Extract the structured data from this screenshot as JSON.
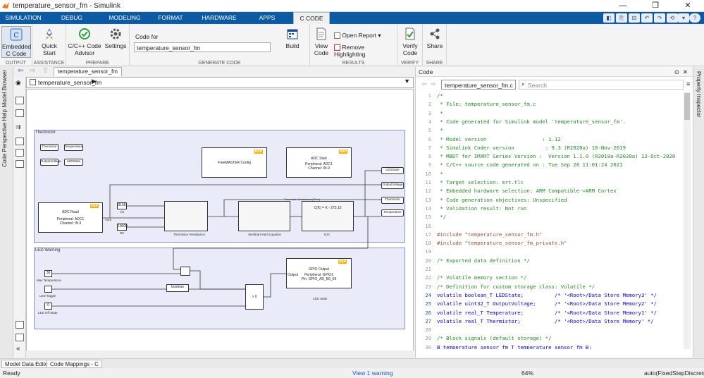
{
  "window": {
    "title": "temperature_sensor_fm - Simulink",
    "controls": [
      "—",
      "❐",
      "✕"
    ]
  },
  "ribbon_tabs": [
    "SIMULATION",
    "DEBUG",
    "MODELING",
    "FORMAT",
    "HARDWARE",
    "APPS",
    "C CODE"
  ],
  "quick_access": [
    "◧",
    "⎘",
    "⊟",
    "↶",
    "↷",
    "⟲",
    "▾",
    "?"
  ],
  "ribbon": {
    "groups": {
      "output": "OUTPUT",
      "assistance": "ASSISTANCE",
      "prepare": "PREPARE",
      "generate_code": "GENERATE CODE",
      "results": "RESULTS",
      "verify": "VERIFY",
      "share": "SHARE"
    },
    "embedded_label": "Embedded",
    "embedded_sub": "C Code",
    "quick_start_1": "Quick",
    "quick_start_2": "Start",
    "advisor_1": "C/C++ Code",
    "advisor_2": "Advisor",
    "settings": "Settings",
    "code_for_label": "Code for",
    "code_for_value": "temperature_sensor_fm",
    "build": "Build",
    "view_code_1": "View",
    "view_code_2": "Code",
    "open_report": "Open Report",
    "remove_highlighting": "Remove Highlighting",
    "verify_code_1": "Verify",
    "verify_code_2": "Code",
    "share": "Share"
  },
  "editor": {
    "tab": "temperature_sensor_fm",
    "breadcrumb": "temperature_sensor_fm"
  },
  "side_tabs": [
    "Model Browser",
    "Code Perspective Help"
  ],
  "right_tab": "Property Inspector",
  "diagram": {
    "thermistor_area": "Thermistor",
    "led_area": "LED Warning",
    "top_ports": [
      "Thermistor",
      "Temperature",
      "OutputVoltage",
      "LEDState"
    ],
    "freemaster": "FreeMASTER Config",
    "adc_start": "ADC Start",
    "adc_start_info": "Peripheral: ADC1",
    "adc_start_ch": "Channel: IN.9",
    "adc_read": "ADC Read",
    "adc_read_info": "Peripheral: ADC1",
    "adc_read_ch": "Channel: IN.9",
    "vout": "Vout",
    "const_vin": "8168",
    "vin": "Vin",
    "const_r0": "10000",
    "r0": "R0",
    "thermistor_res": "Thermistor Resistance",
    "steinhart": "Steinhart-Hart Equation",
    "k2c": "K2C",
    "k2c_formula": "C(K) = K - 273.15",
    "signal_label": "Thermistor Resistance(Ohm)",
    "out_ports": [
      "LEDState",
      "OutputVoltage",
      "Thermistor",
      "Temperature"
    ],
    "max_temp_val": "36",
    "max_temp": "Max Temperature",
    "led_toggle": "LED Toggle",
    "led_off_val": "0",
    "led_off": "LED Off State",
    "boolean": "boolean",
    "gpio": "GPIO Output",
    "gpio_info": "Peripheral: GPIO1",
    "gpio_pin": "Pin: GPIO_AD_B0_09",
    "led_state": "LED State",
    "output_port": "Output",
    "switch_gt": "> 0",
    "nxp": "NXP"
  },
  "code_panel": {
    "title": "Code",
    "file_select": "temperature_sensor_fm.c",
    "search_placeholder": "Search",
    "lines": [
      {
        "n": "1",
        "t": "/*",
        "c": "cmt"
      },
      {
        "n": "2",
        "t": " * File: temperature_sensor_fm.c",
        "c": "cmt"
      },
      {
        "n": "3",
        "t": " *",
        "c": "cmt"
      },
      {
        "n": "4",
        "t": " * Code generated for Simulink model 'temperature_sensor_fm'.",
        "c": "cmt"
      },
      {
        "n": "5",
        "t": " *",
        "c": "cmt"
      },
      {
        "n": "6",
        "t": " * Model version                  : 1.12",
        "c": "cmt"
      },
      {
        "n": "7",
        "t": " * Simulink Coder version          : 9.3 (R2020a) 18-Nov-2019",
        "c": "cmt"
      },
      {
        "n": "8",
        "t": " * MBDT for IMXRT Series Version :  Version 1.1.0 (R2019a-R2020a) 13-Oct-2020",
        "c": "cmt"
      },
      {
        "n": "9",
        "t": " * C/C++ source code generated on : Tue Sep 28 11:01:24 2021",
        "c": "cmt"
      },
      {
        "n": "10",
        "t": " *",
        "c": "cmt"
      },
      {
        "n": "11",
        "t": " * Target selection: ert.tlc",
        "c": "cmt"
      },
      {
        "n": "12",
        "t": " * Embedded hardware selection: ARM Compatible->ARM Cortex",
        "c": "cmt"
      },
      {
        "n": "13",
        "t": " * Code generation objectives: Unspecified",
        "c": "cmt"
      },
      {
        "n": "14",
        "t": " * Validation result: Not run",
        "c": "cmt"
      },
      {
        "n": "15",
        "t": " */",
        "c": "cmt"
      },
      {
        "n": "16",
        "t": "",
        "c": ""
      },
      {
        "n": "17",
        "t": "#include \"temperature_sensor_fm.h\"",
        "c": "pp"
      },
      {
        "n": "18",
        "t": "#include \"temperature_sensor_fm_private.h\"",
        "c": "pp"
      },
      {
        "n": "19",
        "t": "",
        "c": ""
      },
      {
        "n": "20",
        "t": "/* Exported data definition */",
        "c": "cmt"
      },
      {
        "n": "21",
        "t": "",
        "c": ""
      },
      {
        "n": "22",
        "t": "/* Volatile memory section */",
        "c": "cmt"
      },
      {
        "n": "23",
        "t": "/* Definition for custom storage class: Volatile */",
        "c": "cmt"
      },
      {
        "n": "24",
        "t": "volatile boolean_T LEDState;          /* '<Root>/Data Store Memory3' */",
        "c": "kw",
        "hl": true
      },
      {
        "n": "25",
        "t": "volatile uint32_T OutputVoltage;      /* '<Root>/Data Store Memory2' */",
        "c": "kw",
        "hl": true
      },
      {
        "n": "26",
        "t": "volatile real_T Temperature;          /* '<Root>/Data Store Memory1' */",
        "c": "kw",
        "hl": true
      },
      {
        "n": "27",
        "t": "volatile real_T Thermistor;           /* '<Root>/Data Store Memory' */",
        "c": "kw",
        "hl": true
      },
      {
        "n": "28",
        "t": "",
        "c": ""
      },
      {
        "n": "29",
        "t": "/* Block signals (default storage) */",
        "c": "cmt"
      },
      {
        "n": "30",
        "t": "B_temperature_sensor_fm_T temperature_sensor_fm_B;",
        "c": "kw"
      }
    ]
  },
  "bottom_tabs": [
    "Model Data Editor",
    "Code Mappings - C"
  ],
  "status": {
    "left": "Ready",
    "warning": "View 1 warning",
    "zoom": "64%",
    "solver": "auto(FixedStepDiscrete)"
  },
  "colors": {
    "ribbon_blue": "#0b5aa3",
    "nxp_yellow": "#f7b500"
  }
}
